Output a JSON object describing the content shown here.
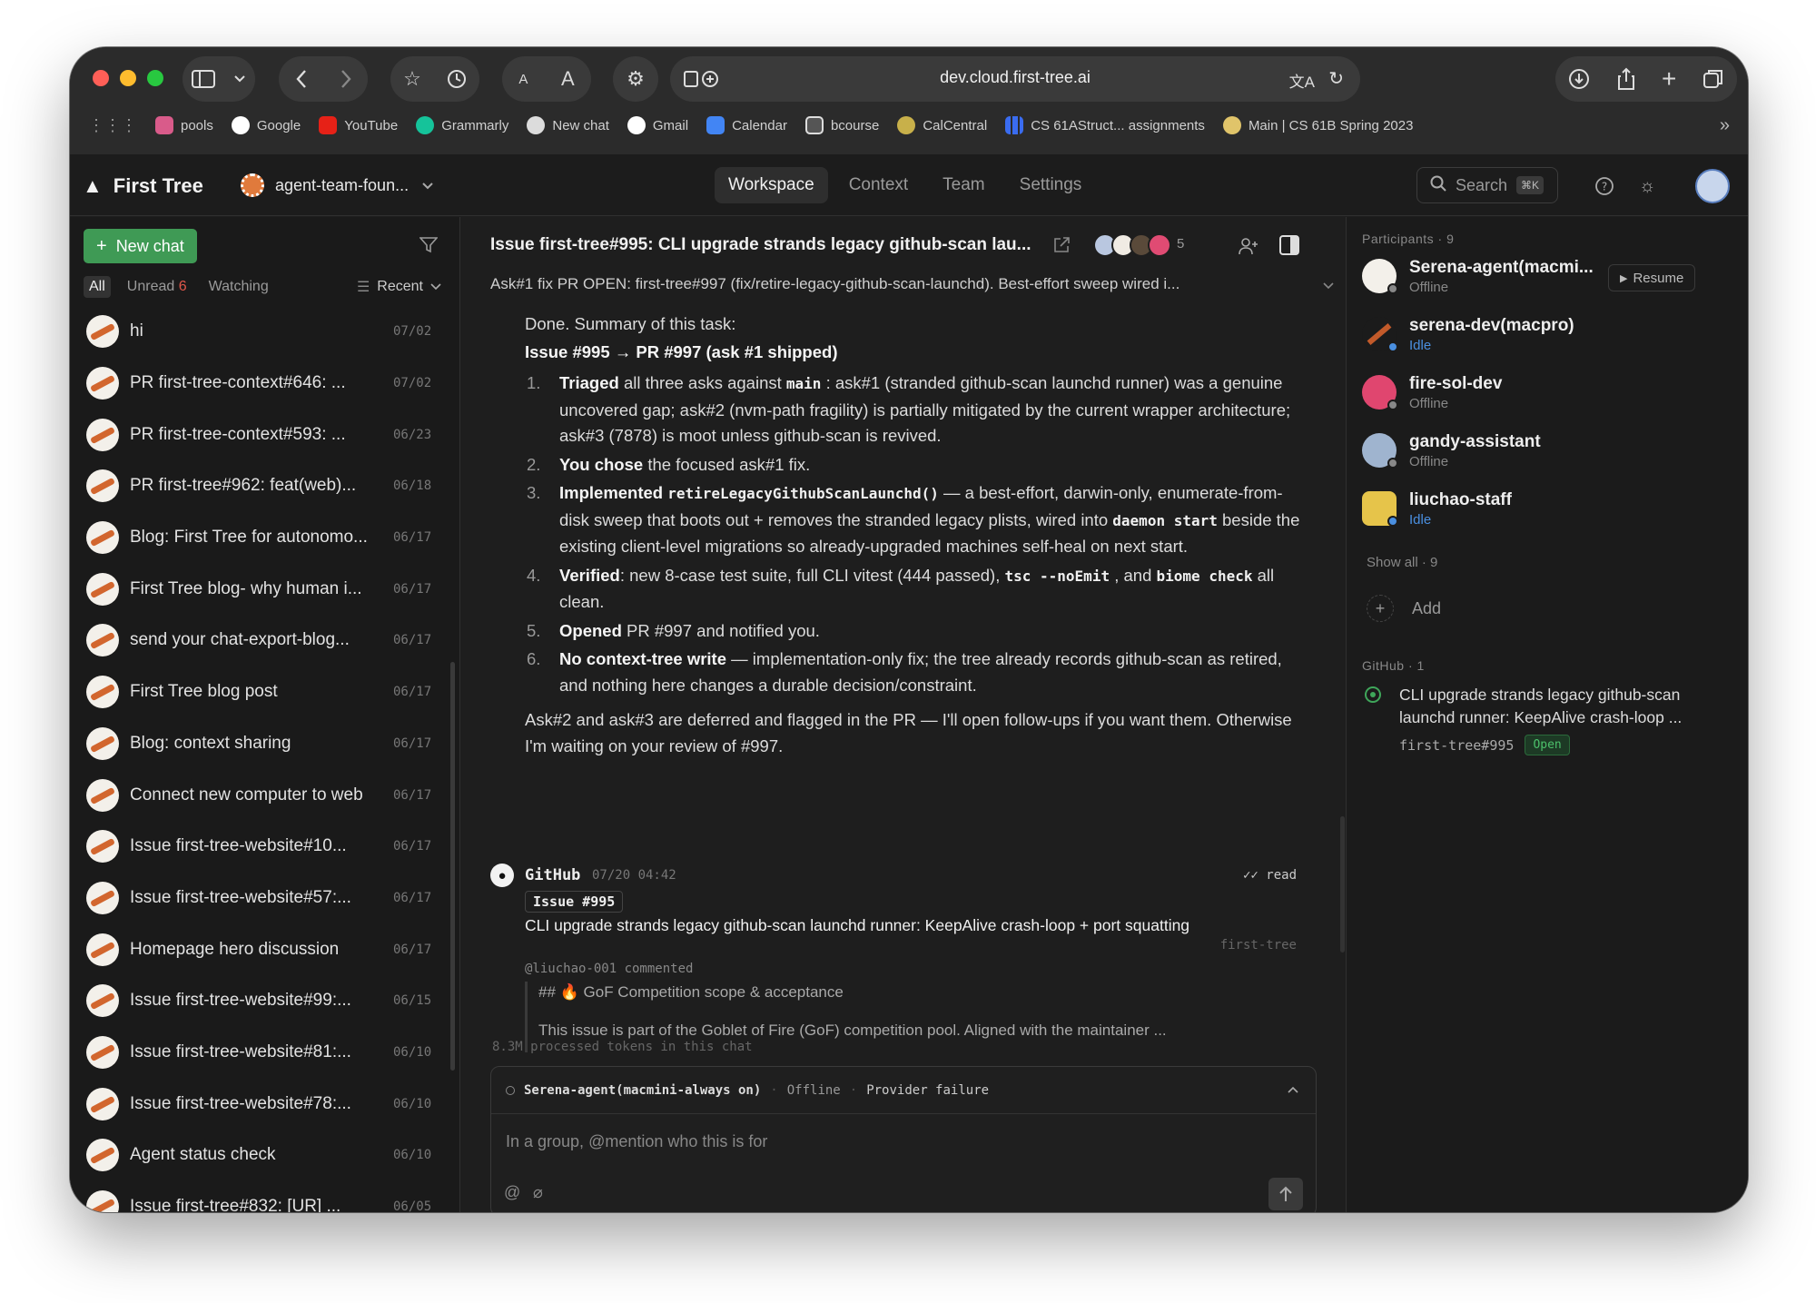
{
  "browser": {
    "url": "dev.cloud.first-tree.ai",
    "bookmarks": [
      "pools",
      "Google",
      "YouTube",
      "Grammarly",
      "New chat",
      "Gmail",
      "Calendar",
      "bcourse",
      "CalCentral",
      "CS 61AStruct... assignments",
      "Main | CS 61B Spring 2023"
    ]
  },
  "app": {
    "name": "First Tree",
    "workspace": "agent-team-foun...",
    "tabs": [
      "Workspace",
      "Context",
      "Team",
      "Settings"
    ],
    "search_label": "Search",
    "search_kbd": "⌘K"
  },
  "sidebar": {
    "new_chat": "New chat",
    "filters": {
      "all": "All",
      "unread": "Unread",
      "unread_count": "6",
      "watching": "Watching",
      "sort": "Recent"
    },
    "chats": [
      {
        "title": "hi",
        "date": "07/02"
      },
      {
        "title": "PR first-tree-context#646: ...",
        "date": "07/02"
      },
      {
        "title": "PR first-tree-context#593: ...",
        "date": "06/23"
      },
      {
        "title": "PR first-tree#962: feat(web)...",
        "date": "06/18"
      },
      {
        "title": "Blog: First Tree for autonomo...",
        "date": "06/17"
      },
      {
        "title": "First Tree blog- why human i...",
        "date": "06/17"
      },
      {
        "title": "send your chat-export-blog...",
        "date": "06/17"
      },
      {
        "title": "First Tree blog post",
        "date": "06/17"
      },
      {
        "title": "Blog: context sharing",
        "date": "06/17"
      },
      {
        "title": "Connect new computer to web",
        "date": "06/17"
      },
      {
        "title": "Issue first-tree-website#10...",
        "date": "06/17"
      },
      {
        "title": "Issue first-tree-website#57:...",
        "date": "06/17"
      },
      {
        "title": "Homepage hero discussion",
        "date": "06/17"
      },
      {
        "title": "Issue first-tree-website#99:...",
        "date": "06/15"
      },
      {
        "title": "Issue first-tree-website#81:...",
        "date": "06/10"
      },
      {
        "title": "Issue first-tree-website#78:...",
        "date": "06/10"
      },
      {
        "title": "Agent status check",
        "date": "06/10"
      },
      {
        "title": "Issue first-tree#832: [UR] ...",
        "date": "06/05"
      }
    ]
  },
  "chat": {
    "title": "Issue first-tree#995: CLI upgrade strands legacy github-scan lau...",
    "member_count": "5",
    "summary_line": "Ask#1 fix PR OPEN: first-tree#997 (fix/retire-legacy-github-scan-launchd). Best-effort sweep wired i...",
    "done": "Done. Summary of this task:",
    "heading": "Issue #995 → PR #997 (ask #1 shipped)",
    "steps": [
      {
        "n": "1.",
        "strong": "Triaged",
        "a": " all three asks against ",
        "code": "main",
        "b": ": ask#1 (stranded github-scan launchd runner) was a genuine uncovered gap; ask#2 (nvm-path fragility) is partially mitigated by the current wrapper architecture; ask#3 (7878) is moot unless github-scan is revived."
      },
      {
        "n": "2.",
        "strong": "You chose",
        "a": " the focused ask#1 fix.",
        "code": "",
        "b": ""
      },
      {
        "n": "3.",
        "strong": "Implemented",
        "a": " ",
        "code": "retireLegacyGithubScanLaunchd()",
        "b": " — a best-effort, darwin-only, enumerate-from-disk sweep that boots out + removes the stranded legacy plists, wired into ",
        "code2": "daemon start",
        "c": " beside the existing client-level migrations so already-upgraded machines self-heal on next start."
      },
      {
        "n": "4.",
        "strong": "Verified",
        "a": ": new 8-case test suite, full CLI vitest (444 passed), ",
        "code": "tsc --noEmit",
        "b": ", and ",
        "code2": "biome check",
        "c": " all clean."
      },
      {
        "n": "5.",
        "strong": "Opened",
        "a": " PR #997 and notified you.",
        "code": "",
        "b": ""
      },
      {
        "n": "6.",
        "strong": "No context-tree write",
        "a": " — implementation-only fix; the tree already records github-scan as retired, and nothing here changes a durable decision/constraint.",
        "code": "",
        "b": ""
      }
    ],
    "closing": "Ask#2 and ask#3 are deferred and flagged in the PR — I'll open follow-ups if you want them. Otherwise I'm waiting on your review of #997.",
    "github": {
      "sender": "GitHub",
      "time": "07/20 04:42",
      "read": "read",
      "tag": "Issue #995",
      "title": "CLI upgrade strands legacy github-scan launchd runner: KeepAlive crash-loop + port squatting",
      "repo": "first-tree",
      "commenter": "@liuchao-001 commented",
      "quote_heading": "## 🔥 GoF Competition scope & acceptance",
      "quote_body": "This issue is part of the Goblet of Fire (GoF) competition pool. Aligned with the maintainer ..."
    },
    "tokens": "8.3M processed tokens in this chat",
    "composer": {
      "agent": "Serena-agent(macmini-always on)",
      "status": "Offline",
      "error": "Provider failure",
      "placeholder": "In a group, @mention who this is for"
    }
  },
  "participants": {
    "label": "Participants",
    "count": "9",
    "resume": "Resume",
    "people": [
      {
        "name": "Serena-agent(macmi...",
        "status": "Offline"
      },
      {
        "name": "serena-dev(macpro)",
        "status": "Idle"
      },
      {
        "name": "fire-sol-dev",
        "status": "Offline"
      },
      {
        "name": "gandy-assistant",
        "status": "Offline"
      },
      {
        "name": "liuchao-staff",
        "status": "Idle"
      }
    ],
    "show_all": "Show all · 9",
    "add": "Add",
    "github_label": "GitHub",
    "github_count": "1",
    "issue_title": "CLI upgrade strands legacy github-scan launchd runner: KeepAlive crash-loop ...",
    "issue_ref": "first-tree#995",
    "issue_state": "Open"
  },
  "colors": {
    "accent": "#3f9a55",
    "idle": "#4a8fe0",
    "background": "#1e1e1e"
  }
}
